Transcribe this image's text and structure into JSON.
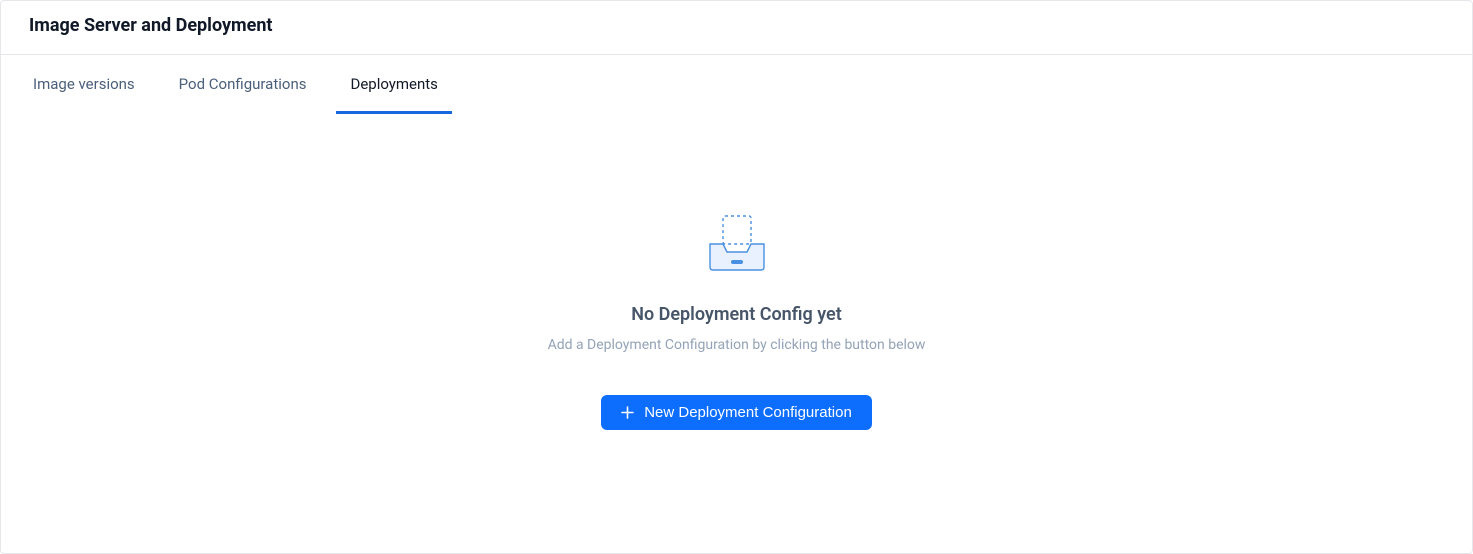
{
  "header": {
    "title": "Image Server and Deployment"
  },
  "tabs": [
    {
      "label": "Image versions",
      "active": false
    },
    {
      "label": "Pod Configurations",
      "active": false
    },
    {
      "label": "Deployments",
      "active": true
    }
  ],
  "emptyState": {
    "title": "No Deployment Config yet",
    "subtitle": "Add a Deployment Configuration by clicking the button below",
    "buttonLabel": "New Deployment Configuration"
  }
}
